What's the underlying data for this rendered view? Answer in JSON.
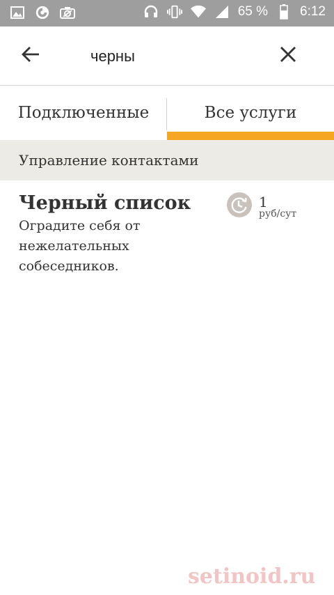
{
  "status_bar": {
    "battery_percent": "65 %",
    "time": "6:12",
    "left_icons": [
      "gallery-icon",
      "firefox-icon",
      "camera-icon"
    ],
    "right_icons": [
      "headset-icon",
      "vibrate-icon",
      "wifi-icon",
      "signal-icon",
      "battery-icon"
    ]
  },
  "search": {
    "query": "черны",
    "back_icon": "arrow-back-icon",
    "clear_icon": "close-icon"
  },
  "tabs": [
    {
      "label": "Подключенные",
      "active": false
    },
    {
      "label": "Все услуги",
      "active": true
    }
  ],
  "section": {
    "title": "Управление контактами"
  },
  "services": [
    {
      "title": "Черный список",
      "description": "Оградите себя от нежелательных собеседников.",
      "price_value": "1",
      "price_unit": "руб/сут",
      "price_icon": "clock-refresh-icon"
    }
  ],
  "watermark": "setinoid.ru",
  "colors": {
    "accent": "#f5a623",
    "status_bar": "#9e9e9e",
    "section_bg": "#ecebe6"
  }
}
